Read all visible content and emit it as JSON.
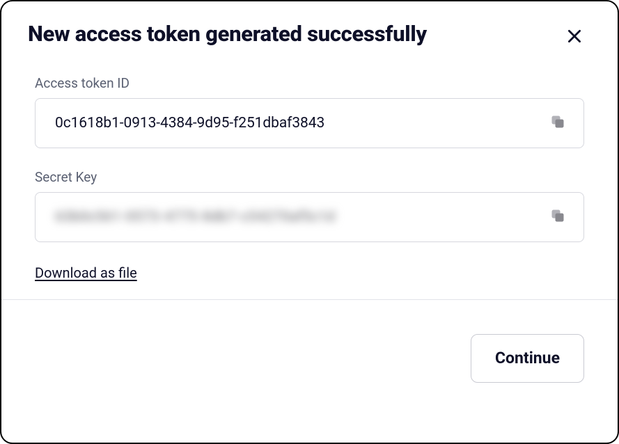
{
  "dialog": {
    "title": "New access token generated successfully"
  },
  "fields": {
    "access_token": {
      "label": "Access token ID",
      "value": "0c1618b1-0913-4384-9d95-f251dbaf3843"
    },
    "secret_key": {
      "label": "Secret Key",
      "value": "63b0c561-0573-4775-8db7-c54270af5c1d"
    }
  },
  "actions": {
    "download_label": "Download as file",
    "continue_label": "Continue"
  }
}
